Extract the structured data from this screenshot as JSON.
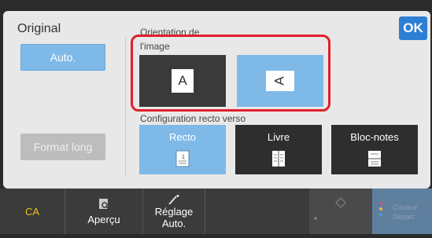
{
  "app": {
    "title": "Original",
    "ok_label": "OK"
  },
  "left": {
    "auto_label": "Auto.",
    "format_long_label": "Format long"
  },
  "orientation": {
    "section_label_line1": "Orientation de",
    "section_label_line2": "l'image",
    "portrait_glyph": "A",
    "landscape_glyph": "A",
    "selected": "landscape"
  },
  "duplex": {
    "section_label": "Configuration recto verso",
    "options": [
      {
        "label": "Recto",
        "selected": true,
        "icon": "single-sided-icon"
      },
      {
        "label": "Livre",
        "selected": false,
        "icon": "book-icon"
      },
      {
        "label": "Bloc-notes",
        "selected": false,
        "icon": "tablet-icon"
      }
    ]
  },
  "bottom": {
    "ca_label": "CA",
    "preview_label": "Aperçu",
    "auto_adjust_line1": "Réglage",
    "auto_adjust_line2": "Auto.",
    "color_start_line1": "Couleur",
    "color_start_line2": "Départ"
  },
  "colors": {
    "accent": "#2d7fd6",
    "selected_button": "#7fb9e8",
    "highlight": "#e0202c",
    "ca_text": "#f6c21b"
  }
}
